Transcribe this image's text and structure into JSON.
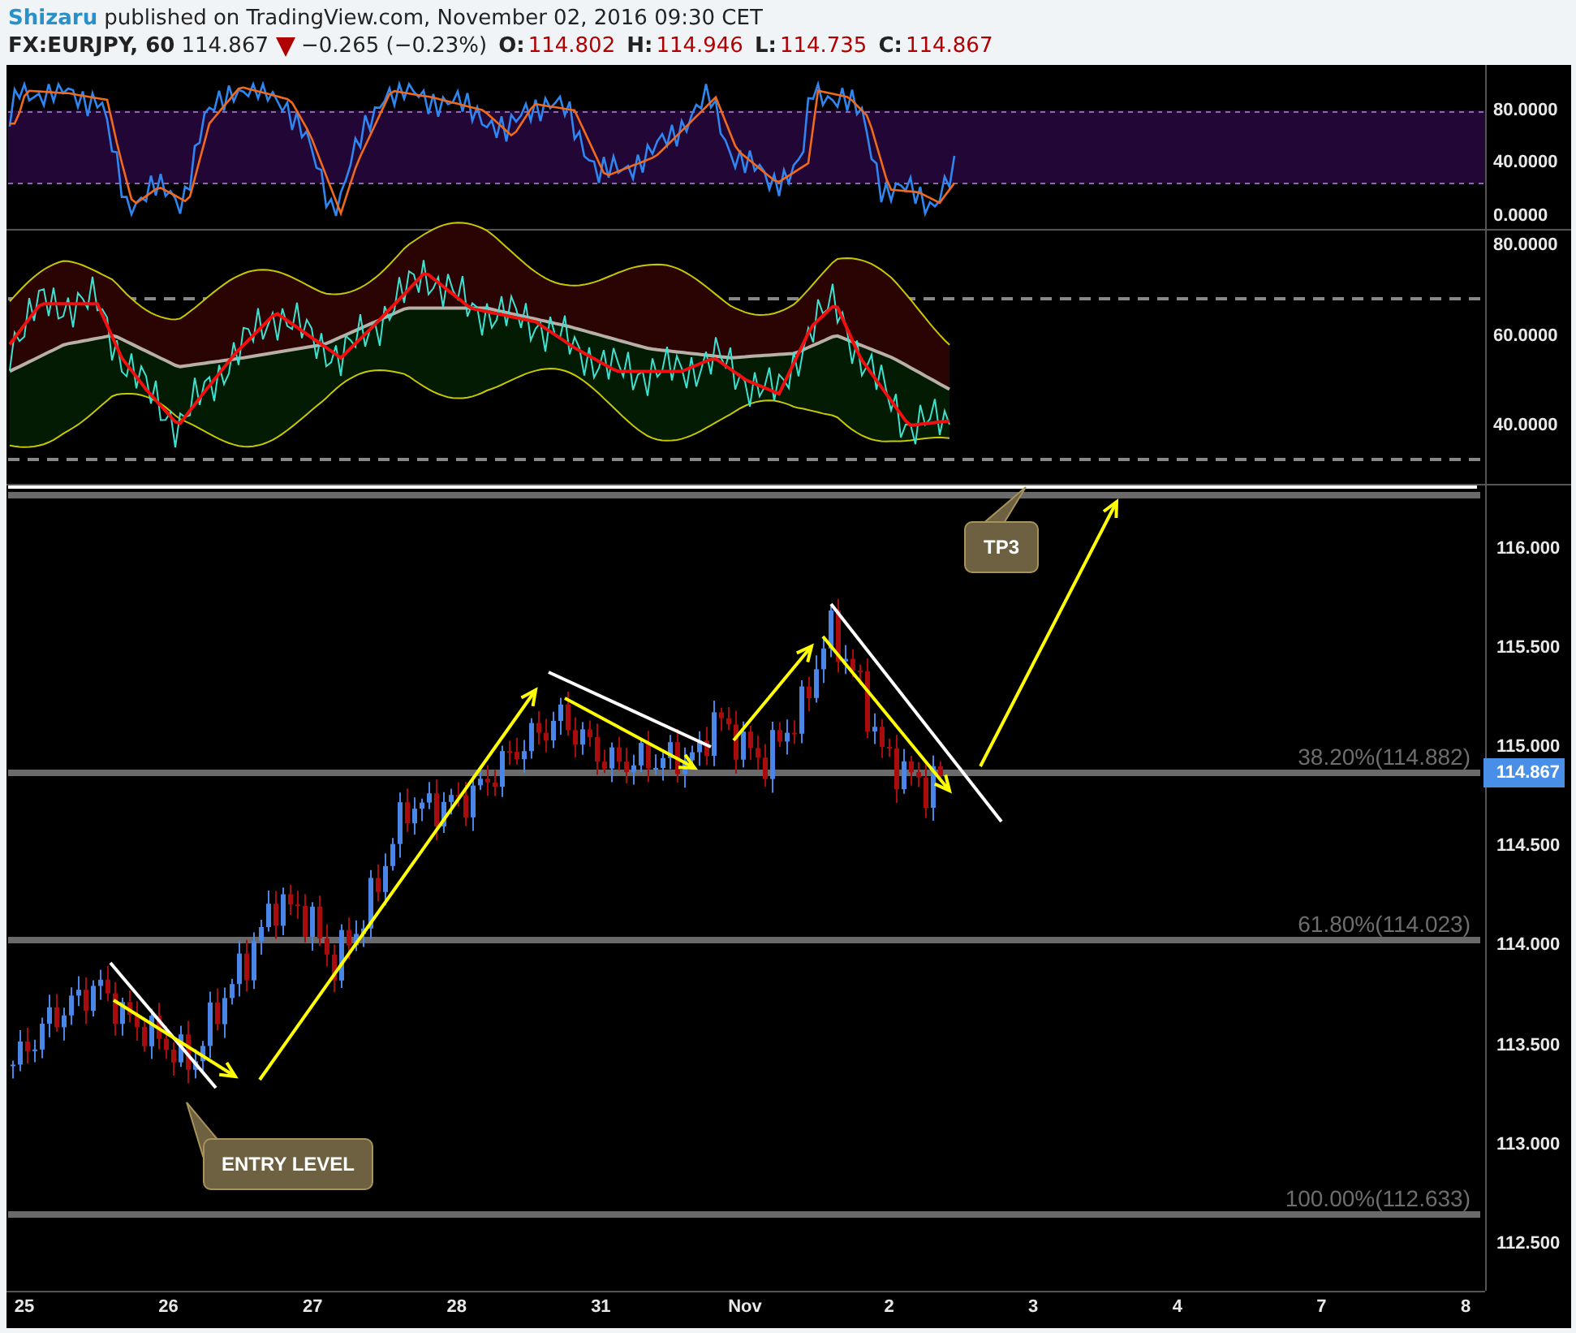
{
  "header": {
    "author": "Shizaru",
    "published": "published on TradingView.com, November 02, 2016 09:30 CET"
  },
  "symbol": {
    "name": "FX:EURJPY, 60",
    "last": "114.867",
    "price_down": true,
    "change": "−0.265 (−0.23%)",
    "ohlc": [
      {
        "label": "O:",
        "value": "114.802"
      },
      {
        "label": "H:",
        "value": "114.946"
      },
      {
        "label": "L:",
        "value": "114.735"
      },
      {
        "label": "C:",
        "value": "114.867"
      }
    ]
  },
  "panes": [
    {
      "kind": "stoch",
      "axis": [
        "80.0000",
        "40.0000",
        "0.0000"
      ]
    },
    {
      "kind": "rsi",
      "axis": [
        "80.0000",
        "60.0000",
        "40.0000"
      ]
    }
  ],
  "price_axis": [
    "116.000",
    "115.500",
    "115.000",
    "114.500",
    "114.000",
    "113.500",
    "113.000",
    "112.500"
  ],
  "last_price_label": "114.867",
  "fib_levels": [
    {
      "label": "38.20%(114.882)"
    },
    {
      "label": "61.80%(114.023)"
    },
    {
      "label": "100.00%(112.633)"
    }
  ],
  "callouts": [
    {
      "kind": "target",
      "text": "TP3"
    },
    {
      "kind": "entry",
      "text": "ENTRY LEVEL"
    }
  ],
  "time_axis": [
    "25",
    "26",
    "27",
    "28",
    "31",
    "Nov",
    "2",
    "3",
    "4",
    "7",
    "8"
  ]
}
